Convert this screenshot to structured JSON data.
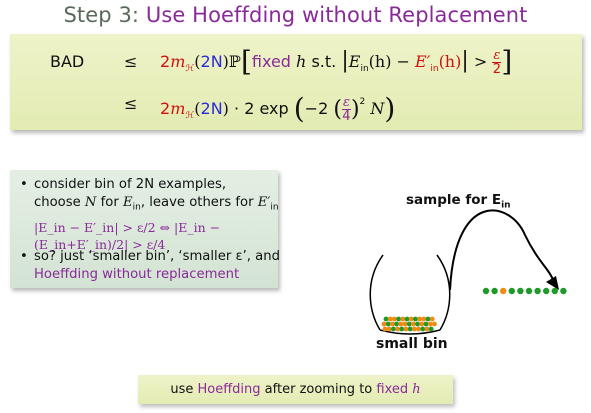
{
  "title": {
    "prefix": "Step 3: ",
    "highlight": "Use Hoeffding without Replacement"
  },
  "equation": {
    "bad_label": "BAD",
    "relation1": "≤",
    "relation2": "≤",
    "line1_coef": "2",
    "line1_growth": "m",
    "line1_growth_sub": "ℋ",
    "line1_growth_arg": "2N",
    "line1_prob": "ℙ",
    "line1_fixed": "fixed",
    "line1_h": "h",
    "line1_st": "s.t.",
    "line1_ein": "E",
    "line1_ein_sub": "in",
    "line1_ein_arg": "(h)",
    "line1_eprime": "E′",
    "line1_eprime_sub": "in",
    "line1_eprime_arg": "(h)",
    "line1_eps": "ε",
    "line1_eps_den": "2",
    "line2_mult": "· 2 exp",
    "line2_minus2": "−2",
    "line2_eps": "ε",
    "line2_eps_den": "4",
    "line2_exp": "2",
    "line2_N": "N"
  },
  "bullets": {
    "b1_l1": "consider bin of 2N examples,",
    "b1_l2a": "choose ",
    "b1_l2b": "N",
    "b1_l2c": " for ",
    "b1_l2d": ", leave others for ",
    "b1_math": "|E_in − E′_in| > ε/2 ⇔ |E_in − (E_in+E′_in)/2| > ε/4",
    "b2_l1": "so? just ‘smaller bin’, ‘smaller ε’, and",
    "b2_l2": "Hoeffding without replacement"
  },
  "diagram": {
    "sample_label": "sample for E",
    "sample_sub": "in",
    "bin_label": "small bin",
    "ball_colors": {
      "orange": "#f08a10",
      "green": "#1e9a2a"
    }
  },
  "bottom": {
    "prefix": "use ",
    "hoeffding": "Hoeffding",
    "middle": " after zooming to ",
    "fixed": "fixed ",
    "h": "h"
  },
  "colors": {
    "title": "#5a6a5a",
    "purple": "#8a2a9a",
    "red": "#d01010",
    "blue": "#2a2ad8"
  }
}
